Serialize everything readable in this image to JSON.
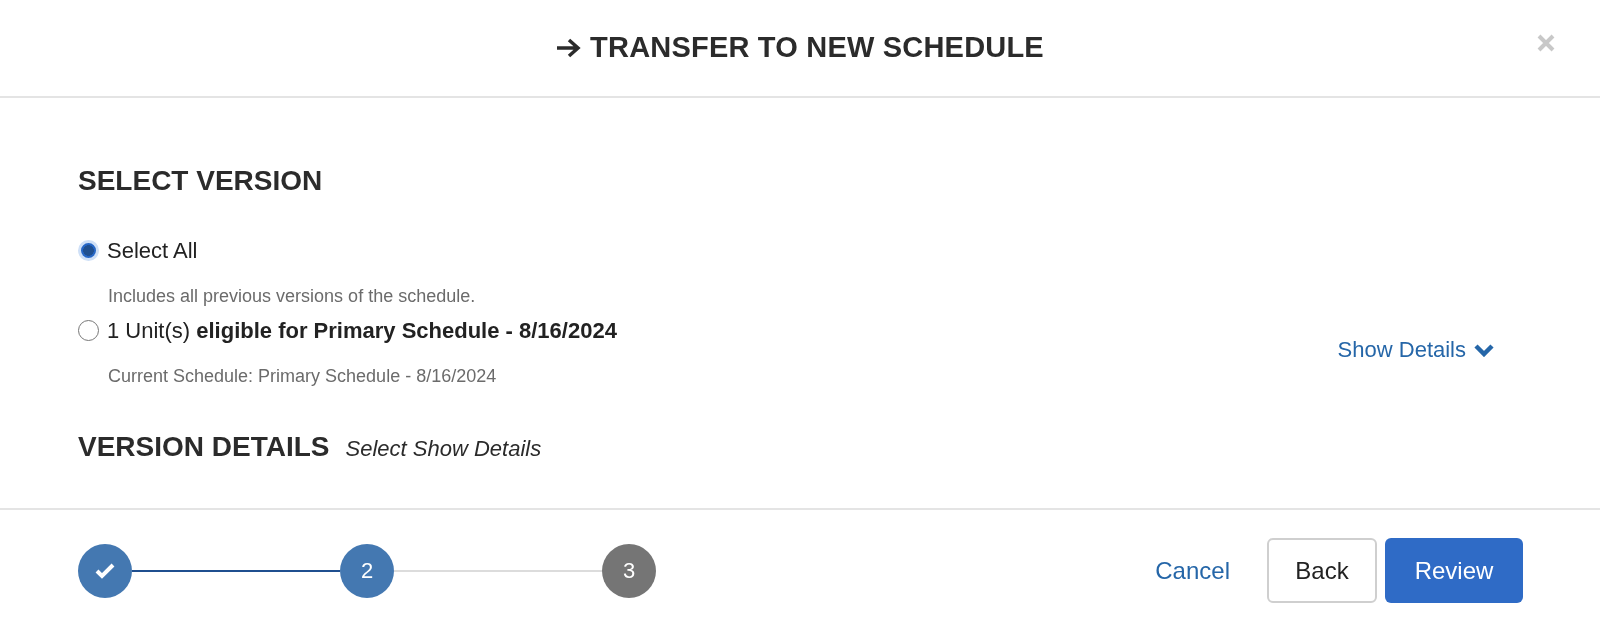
{
  "dialog": {
    "title": "TRANSFER TO NEW SCHEDULE"
  },
  "select_version": {
    "heading": "SELECT VERSION",
    "options": [
      {
        "label": "Select All",
        "description": "Includes all previous versions of the schedule.",
        "selected": true
      },
      {
        "label": "1 Unit(s) **eligible for Primary Schedule - 8/16/2024**",
        "description": "Current Schedule: Primary Schedule - 8/16/2024",
        "selected": false,
        "details_link": "Show Details"
      }
    ]
  },
  "version_details": {
    "heading": "VERSION DETAILS",
    "hint": "Select Show Details"
  },
  "stepper": [
    {
      "completed": true,
      "current": false
    },
    {
      "label": "2",
      "completed": false,
      "current": true
    },
    {
      "label": "3",
      "completed": false,
      "current": false
    }
  ],
  "buttons": [
    {
      "label": "Cancel",
      "kind": "link"
    },
    {
      "label": "Back",
      "kind": "secondary"
    },
    {
      "label": "Review",
      "kind": "primary"
    }
  ]
}
